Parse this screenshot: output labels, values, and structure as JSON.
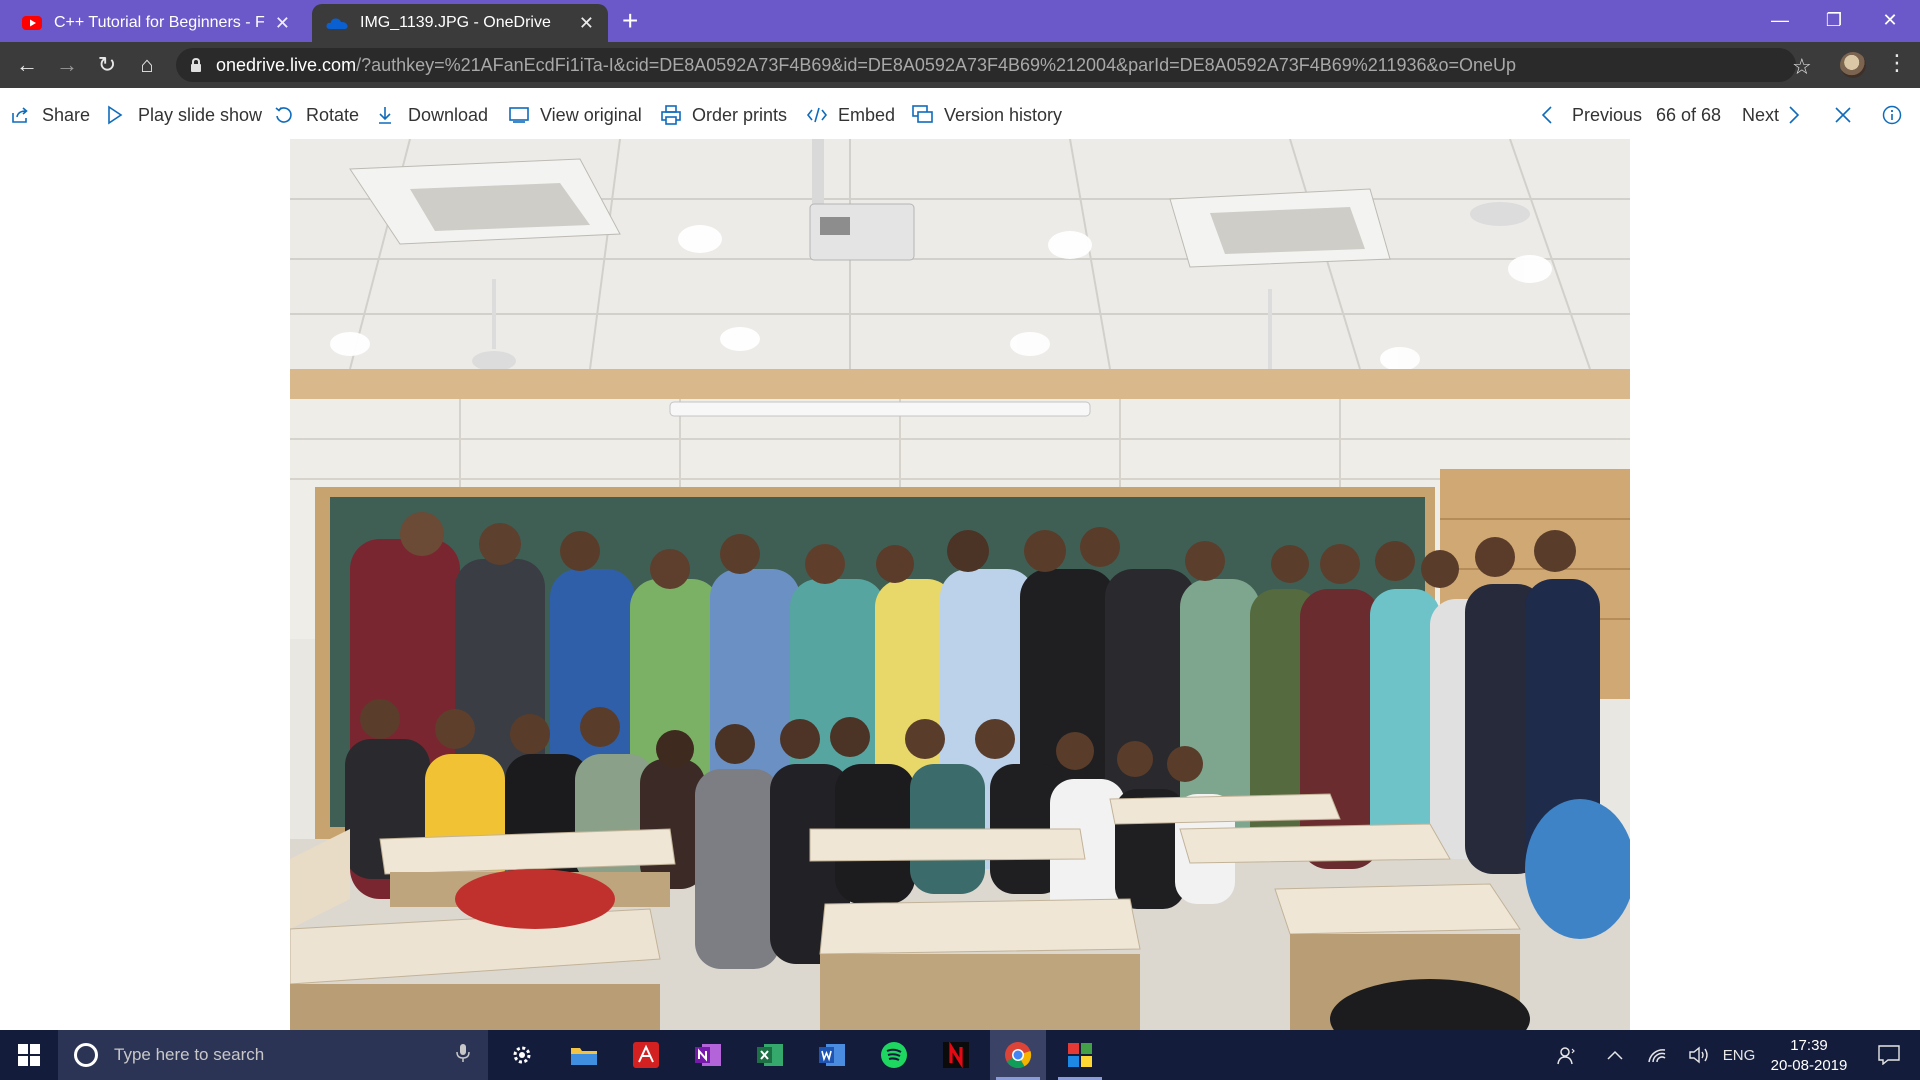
{
  "browser": {
    "tabs": [
      {
        "title": "C++ Tutorial for Beginners - Full",
        "favicon": "youtube-icon",
        "active": false
      },
      {
        "title": "IMG_1139.JPG - OneDrive",
        "favicon": "onedrive-icon",
        "active": true
      }
    ],
    "url_host": "onedrive.live.com",
    "url_rest": "/?authkey=%21AFanEcdFi1iTa-I&cid=DE8A0592A73F4B69&id=DE8A0592A73F4B69%212004&parId=DE8A0592A73F4B69%211936&o=OneUp",
    "accent": "#6c59c9"
  },
  "commandbar": {
    "share": "Share",
    "slideshow": "Play slide show",
    "rotate": "Rotate",
    "download": "Download",
    "view_original": "View original",
    "order_prints": "Order prints",
    "embed": "Embed",
    "version_history": "Version history",
    "previous": "Previous",
    "counter": "66 of 68",
    "next": "Next",
    "icon_color": "#0f6cbd"
  },
  "taskbar": {
    "search_placeholder": "Type here to search",
    "apps": [
      "settings-icon",
      "file-explorer-icon",
      "acrobat-icon",
      "onenote-icon",
      "excel-icon",
      "word-icon",
      "spotify-icon",
      "netflix-icon",
      "chrome-icon",
      "app-icon"
    ],
    "language": "ENG",
    "time": "17:39",
    "date": "20-08-2019"
  }
}
